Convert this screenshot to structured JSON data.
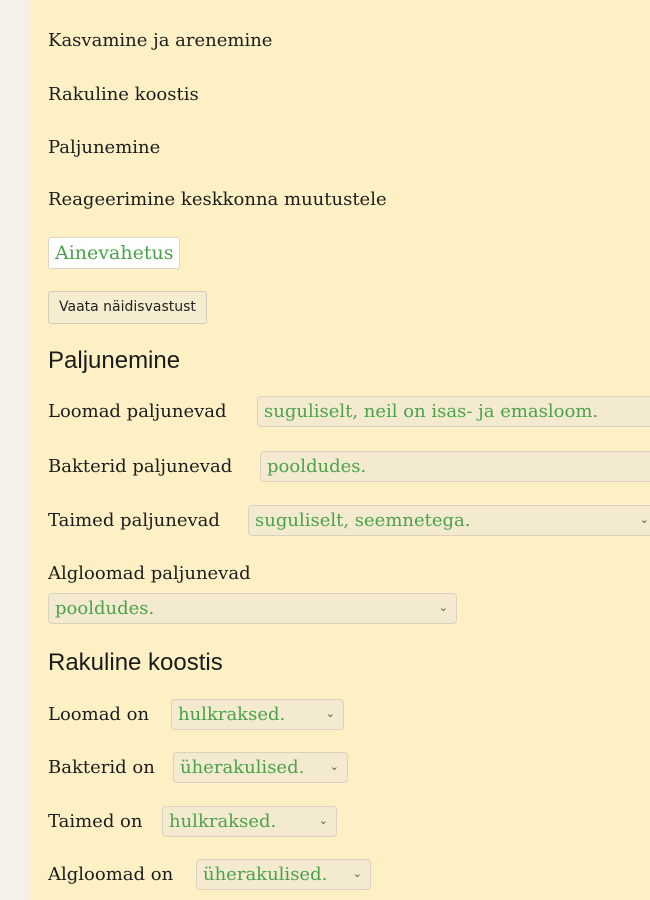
{
  "checklist": {
    "items": [
      "Kasvamine ja arenemine",
      "Rakuline koostis",
      "Paljunemine",
      "Reageerimine keskkonna muutustele"
    ],
    "selected_chip": "Ainevahetus",
    "sample_answer_button": "Vaata näidisvastust"
  },
  "sections": [
    {
      "heading": "Paljunemine",
      "rows": [
        {
          "label": "Loomad paljunevad",
          "value": "suguliselt, neil on isas- ja emasloom."
        },
        {
          "label": "Bakterid paljunevad",
          "value": "pooldudes."
        },
        {
          "label": "Taimed paljunevad",
          "value": "suguliselt, seemnetega."
        },
        {
          "label": "Algloomad paljunevad",
          "value": "pooldudes."
        }
      ]
    },
    {
      "heading": "Rakuline koostis",
      "rows": [
        {
          "label": "Loomad on",
          "value": "hulkraksed."
        },
        {
          "label": "Bakterid on",
          "value": "üherakulised."
        },
        {
          "label": "Taimed on",
          "value": "hulkraksed."
        },
        {
          "label": "Algloomad on",
          "value": "üherakulised."
        }
      ]
    }
  ],
  "icons": {
    "dropdown": "chevron-down-icon"
  },
  "colors": {
    "panel_bg": "#fdf0c5",
    "answer_green": "#4aa34a",
    "outer_bg": "#f4f1ea"
  }
}
